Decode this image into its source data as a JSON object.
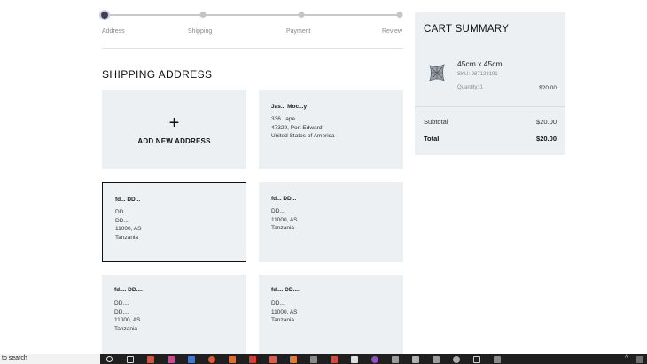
{
  "checkout": {
    "steps": [
      {
        "label": "Address",
        "active": true
      },
      {
        "label": "Shipping",
        "active": false
      },
      {
        "label": "Payment",
        "active": false
      },
      {
        "label": "Review",
        "active": false
      }
    ]
  },
  "shipping": {
    "title": "SHIPPING ADDRESS",
    "add_new_label": "ADD NEW ADDRESS",
    "add_icon": "plus-icon",
    "addresses": [
      {
        "name": "Jas... Moc...y",
        "lines": [
          "336...ape",
          "47329, Port Edward",
          "United States of America"
        ],
        "selected": false
      },
      {
        "name": "fd... DD...",
        "lines": [
          "DD...",
          "DD...",
          "11000, AS",
          "Tanzania"
        ],
        "selected": true
      },
      {
        "name": "fd... DD...",
        "lines": [
          "DD...",
          "11000, AS",
          "Tanzania"
        ],
        "selected": false
      },
      {
        "name": "fd.... DD....",
        "lines": [
          "DD....",
          "DD....",
          "11000, AS",
          "Tanzania"
        ],
        "selected": false
      },
      {
        "name": "fd.... DD....",
        "lines": [
          "DD....",
          "11000, AS",
          "Tanzania"
        ],
        "selected": false
      }
    ]
  },
  "cart": {
    "title": "CART SUMMARY",
    "item": {
      "image_icon": "cushion-product-image",
      "name": "45cm x 45cm",
      "sku": "SKU: 987128191",
      "quantity": "Quantity: 1",
      "price": "$20.00"
    },
    "subtotal_label": "Subtotal",
    "subtotal_value": "$20.00",
    "total_label": "Total",
    "total_value": "$20.00"
  },
  "taskbar": {
    "search_text": "to search",
    "start_icon": "windows-start-icon",
    "accent": "#1f1f1f"
  }
}
